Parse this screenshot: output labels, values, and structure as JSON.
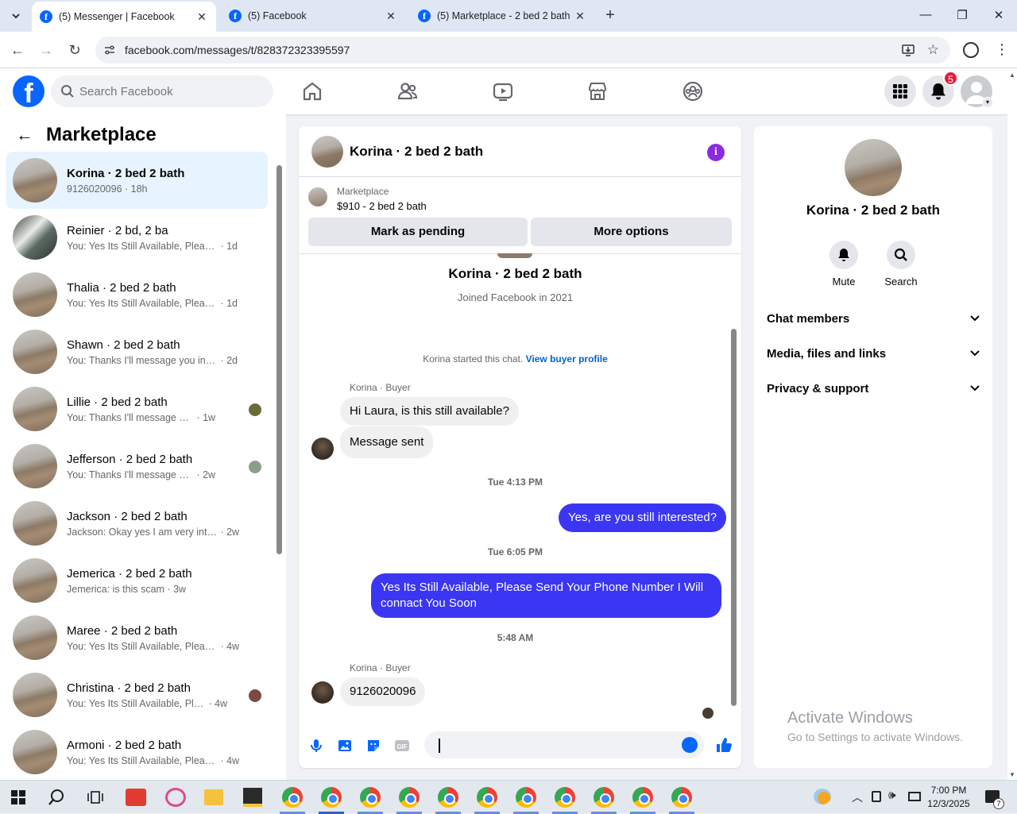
{
  "browser": {
    "tabs": [
      {
        "title": "(5) Messenger | Facebook",
        "active": true
      },
      {
        "title": "(5) Facebook",
        "active": false
      },
      {
        "title": "(5) Marketplace - 2 bed 2 bath",
        "active": false
      }
    ],
    "url": "facebook.com/messages/t/828372323395597"
  },
  "fb_header": {
    "search_placeholder": "Search Facebook",
    "notification_count": "5"
  },
  "left": {
    "title": "Marketplace",
    "conversations": [
      {
        "name": "Korina · 2 bed 2 bath",
        "preview": "9126020096",
        "time": "18h",
        "selected": true
      },
      {
        "name": "Reinier · 2 bd, 2 ba",
        "preview": "You: Yes Its Still Available, Please Se...",
        "time": "1d"
      },
      {
        "name": "Thalia · 2 bed 2 bath",
        "preview": "You: Yes Its Still Available, Please Se...",
        "time": "1d"
      },
      {
        "name": "Shawn · 2 bed 2 bath",
        "preview": "You: Thanks I'll message you in a m...",
        "time": "2d"
      },
      {
        "name": "Lillie · 2 bed 2 bath",
        "preview": "You: Thanks I'll message you in ...",
        "time": "1w"
      },
      {
        "name": "Jefferson · 2 bed 2 bath",
        "preview": "You: Thanks I'll message you in ...",
        "time": "2w"
      },
      {
        "name": "Jackson · 2 bed 2 bath",
        "preview": "Jackson: Okay yes I am very interes...",
        "time": "2w"
      },
      {
        "name": "Jemerica · 2 bed 2 bath",
        "preview": "Jemerica: is this scam",
        "time": "3w"
      },
      {
        "name": "Maree · 2 bed 2 bath",
        "preview": "You: Yes Its Still Available, Please Se...",
        "time": "4w"
      },
      {
        "name": "Christina · 2 bed 2 bath",
        "preview": "You: Yes Its Still Available, Please...",
        "time": "4w"
      },
      {
        "name": "Armoni · 2 bed 2 bath",
        "preview": "You: Yes Its Still Available, Please Se...",
        "time": "4w"
      }
    ]
  },
  "chat": {
    "title": "Korina · 2 bed 2 bath",
    "listing_label": "Marketplace",
    "listing_price": "$910 - 2 bed 2 bath",
    "mark_pending": "Mark as pending",
    "more_options": "More options",
    "profile_name": "Korina · 2 bed 2 bath",
    "joined": "Joined Facebook in 2021",
    "started_text": "Korina started this chat.",
    "view_buyer": "View buyer profile",
    "sender_label": "Korina · Buyer",
    "msg1": "Hi Laura, is this still available?",
    "msg2": "Message sent",
    "ts1": "Tue 4:13 PM",
    "out1": "Yes, are you still interested?",
    "ts2": "Tue 6:05 PM",
    "out2": "Yes Its Still Available, Please Send Your Phone Number I Will connact You Soon",
    "ts3": "5:48 AM",
    "sender_label2": "Korina · Buyer",
    "msg3": "9126020096"
  },
  "right": {
    "name": "Korina · 2 bed 2 bath",
    "mute": "Mute",
    "search": "Search",
    "sections": [
      "Chat members",
      "Media, files and links",
      "Privacy & support"
    ],
    "activate_title": "Activate Windows",
    "activate_sub": "Go to Settings to activate Windows."
  },
  "taskbar": {
    "time": "7:00 PM",
    "date": "12/3/2025",
    "notif_count": "7"
  }
}
